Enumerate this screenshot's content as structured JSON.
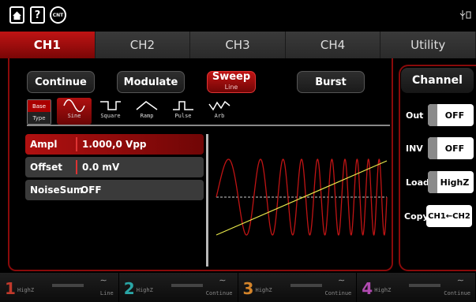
{
  "topbar": {
    "home_icon": "home-icon",
    "help_icon": "help-icon",
    "help_glyph": "?",
    "counter_icon": "counter-icon",
    "counter_glyph": "CNT",
    "usb_icon": "usb-icon",
    "usb_glyph": "⚲⚿"
  },
  "tabs": [
    {
      "label": "CH1",
      "active": true
    },
    {
      "label": "CH2",
      "active": false
    },
    {
      "label": "CH3",
      "active": false
    },
    {
      "label": "CH4",
      "active": false
    },
    {
      "label": "Utility",
      "active": false
    }
  ],
  "modes": {
    "continue": "Continue",
    "modulate": "Modulate",
    "sweep": "Sweep",
    "sweep_sub": "Line",
    "burst": "Burst"
  },
  "base_type": {
    "top": "Base",
    "bottom": "Type"
  },
  "waveforms": [
    {
      "label": "Sine",
      "icon": "sine-wave-icon"
    },
    {
      "label": "Square",
      "icon": "square-wave-icon"
    },
    {
      "label": "Ramp",
      "icon": "ramp-wave-icon"
    },
    {
      "label": "Pulse",
      "icon": "pulse-wave-icon"
    },
    {
      "label": "Arb",
      "icon": "arb-wave-icon"
    }
  ],
  "params": [
    {
      "name": "Ampl",
      "value": "1.000,0 Vpp"
    },
    {
      "name": "Offset",
      "value": "0.0 mV"
    },
    {
      "name": "NoiseSum",
      "value": "OFF"
    }
  ],
  "channel_panel": {
    "title": "Channel",
    "out_label": "Out",
    "out_value": "OFF",
    "inv_label": "INV",
    "inv_value": "OFF",
    "load_label": "Load",
    "load_value": "HighZ",
    "copy_label": "Copy",
    "copy_value": "CH1←CH2"
  },
  "bottom": [
    {
      "num": "1",
      "load": "HighZ",
      "mode": "Line",
      "color": "#c0392b"
    },
    {
      "num": "2",
      "load": "HighZ",
      "mode": "Continue",
      "color": "#2aa5a5"
    },
    {
      "num": "3",
      "load": "HighZ",
      "mode": "Continue",
      "color": "#d4842a"
    },
    {
      "num": "4",
      "load": "HighZ",
      "mode": "Continue",
      "color": "#b04ab0"
    }
  ],
  "colors": {
    "accent": "#c01414",
    "trace": "#c01414",
    "sweep_line": "#e8e84a"
  }
}
